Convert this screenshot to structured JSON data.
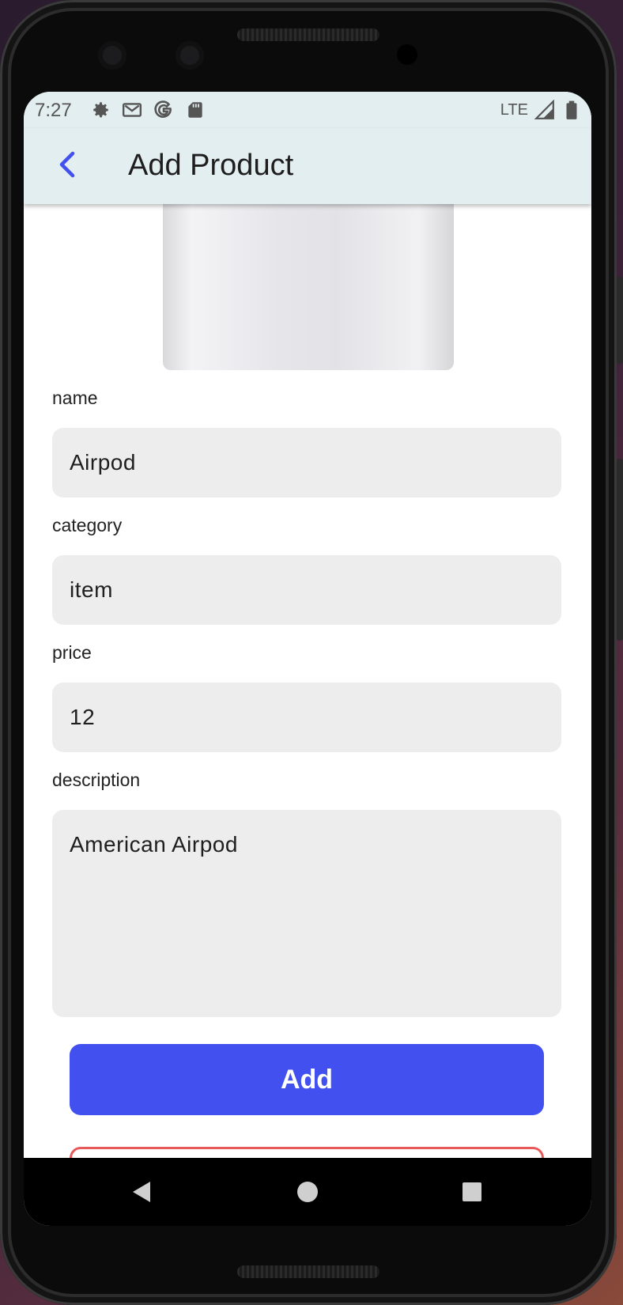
{
  "statusbar": {
    "time": "7:27",
    "left_icons": [
      "gear-icon",
      "gmail-icon",
      "google-icon",
      "sd-card-icon"
    ],
    "network": "LTE",
    "right_icons": [
      "signal-icon",
      "battery-icon"
    ]
  },
  "appbar": {
    "title": "Add Product",
    "back_icon": "chevron-left-icon"
  },
  "form": {
    "name": {
      "label": "name",
      "value": "Airpod"
    },
    "category": {
      "label": "category",
      "value": "item"
    },
    "price": {
      "label": "price",
      "value": "12"
    },
    "description": {
      "label": "description",
      "value": "American Airpod"
    }
  },
  "buttons": {
    "add_label": "Add"
  },
  "navbar": {
    "items": [
      "back-triangle-icon",
      "home-circle-icon",
      "recents-square-icon"
    ]
  },
  "colors": {
    "accent": "#4150ef",
    "appbar_bg": "#e3eef0",
    "field_bg": "#ededed",
    "danger_outline": "#e85a5a"
  }
}
